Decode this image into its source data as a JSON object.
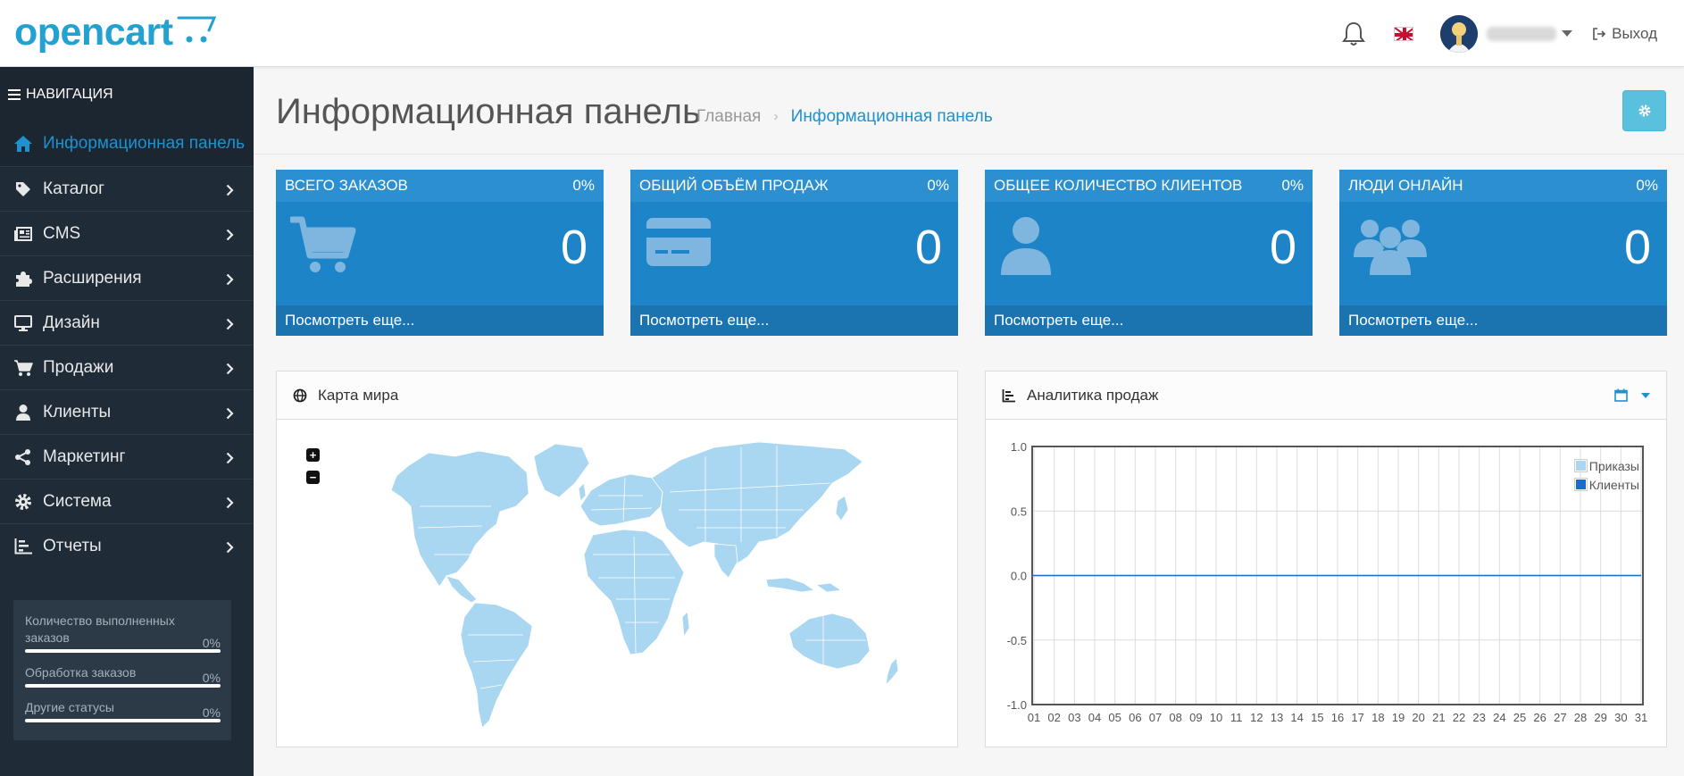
{
  "header": {
    "logo_text": "opencart",
    "logout_label": "Выход"
  },
  "sidebar": {
    "heading": "НАВИГАЦИЯ",
    "items": [
      {
        "label": "Информационная панель",
        "icon": "home-icon",
        "active": true
      },
      {
        "label": "Каталог",
        "icon": "tag-icon"
      },
      {
        "label": "CMS",
        "icon": "newspaper-icon"
      },
      {
        "label": "Расширения",
        "icon": "puzzle-icon"
      },
      {
        "label": "Дизайн",
        "icon": "monitor-icon"
      },
      {
        "label": "Продажи",
        "icon": "cart-icon"
      },
      {
        "label": "Клиенты",
        "icon": "user-icon"
      },
      {
        "label": "Маркетинг",
        "icon": "share-icon"
      },
      {
        "label": "Система",
        "icon": "gear-icon"
      },
      {
        "label": "Отчеты",
        "icon": "bar-chart-icon"
      }
    ],
    "stats": [
      {
        "label": "Количество выполненных заказов",
        "percent": "0%"
      },
      {
        "label": "Обработка заказов",
        "percent": "0%"
      },
      {
        "label": "Другие статусы",
        "percent": "0%"
      }
    ]
  },
  "page": {
    "title": "Информационная панель",
    "breadcrumb": [
      "Главная",
      "Информационная панель"
    ]
  },
  "tiles": [
    {
      "title": "ВСЕГО ЗАКАЗОВ",
      "percent": "0%",
      "value": "0",
      "link": "Посмотреть еще...",
      "icon": "cart-icon"
    },
    {
      "title": "ОБЩИЙ ОБЪЁМ ПРОДАЖ",
      "percent": "0%",
      "value": "0",
      "link": "Посмотреть еще...",
      "icon": "credit-card-icon"
    },
    {
      "title": "ОБЩЕЕ КОЛИЧЕСТВО КЛИЕНТОВ",
      "percent": "0%",
      "value": "0",
      "link": "Посмотреть еще...",
      "icon": "user-icon"
    },
    {
      "title": "ЛЮДИ ОНЛАЙН",
      "percent": "0%",
      "value": "0",
      "link": "Посмотреть еще...",
      "icon": "users-icon"
    }
  ],
  "map_panel": {
    "title": "Карта мира",
    "zoom_in": "+",
    "zoom_out": "−"
  },
  "sales_panel": {
    "title": "Аналитика продаж"
  },
  "colors": {
    "accent": "#1e91cf",
    "tile": "#1e84c8",
    "sidebar": "#1f2b37",
    "map_land": "#a9d6f0"
  },
  "chart_data": {
    "type": "line",
    "x": [
      "01",
      "02",
      "03",
      "04",
      "05",
      "06",
      "07",
      "08",
      "09",
      "10",
      "11",
      "12",
      "13",
      "14",
      "15",
      "16",
      "17",
      "18",
      "19",
      "20",
      "21",
      "22",
      "23",
      "24",
      "25",
      "26",
      "27",
      "28",
      "29",
      "30",
      "31"
    ],
    "y_ticks": [
      "1.0",
      "0.5",
      "0.0",
      "-0.5",
      "-1.0"
    ],
    "ylim": [
      -1.0,
      1.0
    ],
    "grid": true,
    "legend_position": "top-right",
    "series": [
      {
        "name": "Приказы",
        "color": "#a9d6f0",
        "values": [
          0,
          0,
          0,
          0,
          0,
          0,
          0,
          0,
          0,
          0,
          0,
          0,
          0,
          0,
          0,
          0,
          0,
          0,
          0,
          0,
          0,
          0,
          0,
          0,
          0,
          0,
          0,
          0,
          0,
          0,
          0
        ]
      },
      {
        "name": "Клиенты",
        "color": "#1a6dcc",
        "values": [
          0,
          0,
          0,
          0,
          0,
          0,
          0,
          0,
          0,
          0,
          0,
          0,
          0,
          0,
          0,
          0,
          0,
          0,
          0,
          0,
          0,
          0,
          0,
          0,
          0,
          0,
          0,
          0,
          0,
          0,
          0
        ]
      }
    ]
  }
}
